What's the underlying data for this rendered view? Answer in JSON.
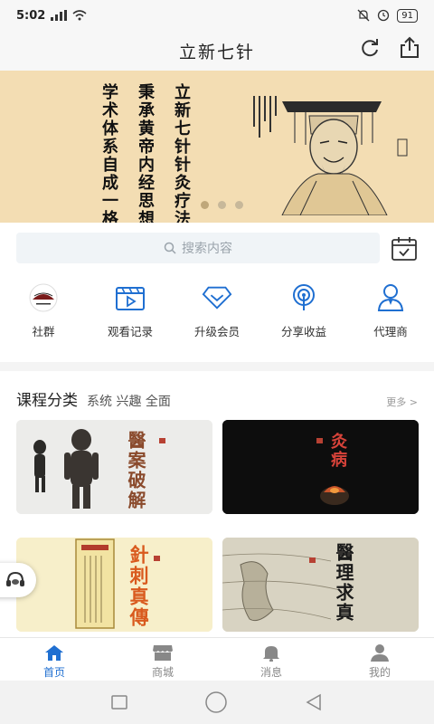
{
  "status_bar": {
    "time": "5:02",
    "battery": "91"
  },
  "header": {
    "title": "立新七针"
  },
  "banner": {
    "lines": [
      "立新七针针灸疗法",
      "秉承黄帝内经思想",
      "学术体系自成一格"
    ]
  },
  "search": {
    "placeholder": "搜索内容"
  },
  "quick_menu": [
    {
      "label": "社群",
      "icon": "community-logo-icon"
    },
    {
      "label": "观看记录",
      "icon": "video-play-icon"
    },
    {
      "label": "升级会员",
      "icon": "diamond-icon"
    },
    {
      "label": "分享收益",
      "icon": "broadcast-icon"
    },
    {
      "label": "代理商",
      "icon": "agent-person-icon"
    }
  ],
  "courses_section": {
    "title": "课程分类",
    "tags": "系统 兴趣 全面",
    "more": "更多 >"
  },
  "courses": [
    {
      "title": "醫案破解"
    },
    {
      "title": "灸病"
    },
    {
      "title": "針刺真傳"
    },
    {
      "title": "醫理求真"
    }
  ],
  "tabs": [
    {
      "label": "首页",
      "active": true,
      "icon": "home-icon"
    },
    {
      "label": "商城",
      "active": false,
      "icon": "store-icon"
    },
    {
      "label": "消息",
      "active": false,
      "icon": "bell-icon"
    },
    {
      "label": "我的",
      "active": false,
      "icon": "person-icon"
    }
  ],
  "colors": {
    "accent": "#1f6fd1",
    "banner_bg": "#f3ddb3"
  }
}
